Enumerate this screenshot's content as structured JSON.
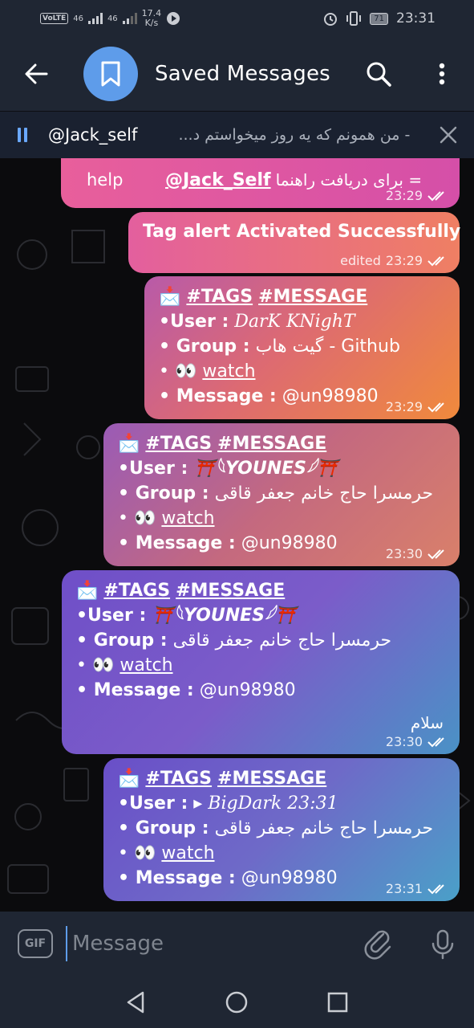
{
  "status_bar": {
    "volte": "VoLTE",
    "signal1": "46",
    "signal2": "46",
    "speed_value": "17.4",
    "speed_unit": "K/s",
    "battery": "71",
    "time": "23:31"
  },
  "header": {
    "title": "Saved Messages"
  },
  "pinned": {
    "sender": "@Jack_self",
    "text": "- من همونم که یه روز میخواستم د..."
  },
  "messages": [
    {
      "text_left": "help",
      "text_link": "@Jack_Self",
      "text_rtl": "= برای دریافت راهنما",
      "time": "23:29"
    },
    {
      "text": "Tag alert Activated Successfully",
      "edited": "edited",
      "time": "23:29"
    },
    {
      "tags": "#TAGS",
      "message_tag": "#MESSAGE",
      "user_label": "•User :",
      "user_value": "DarK KNighT",
      "group_label": "• Group :",
      "group_value": "گیت هاب - Github",
      "watch_prefix": "• 👀",
      "watch_label": "watch",
      "message_label": "• Message :",
      "message_value": "@un98980",
      "time": "23:29"
    },
    {
      "tags": "#TAGS",
      "message_tag": "#MESSAGE",
      "user_label": "•User :",
      "user_value": "⛩️𓆩YOUNES𓆪⛩️",
      "group_label": "• Group :",
      "group_value": "حرمسرا حاج خانم جعفر قاقی",
      "watch_prefix": "• 👀",
      "watch_label": "watch",
      "message_label": "• Message :",
      "message_value": "@un98980",
      "time": "23:30"
    },
    {
      "tags": "#TAGS",
      "message_tag": "#MESSAGE",
      "user_label": "•User :",
      "user_value": "⛩️𓆩YOUNES𓆪⛩️",
      "group_label": "• Group :",
      "group_value": "حرمسرا حاج خانم جعفر قاقی",
      "watch_prefix": "• 👀",
      "watch_label": "watch",
      "message_label": "• Message :",
      "message_value": "@un98980",
      "extra": "سلام",
      "time": "23:30"
    },
    {
      "tags": "#TAGS",
      "message_tag": "#MESSAGE",
      "user_label": "•User :",
      "user_value": "▸ BigDark 23:31",
      "group_label": "• Group :",
      "group_value": "حرمسرا حاج خانم جعفر قاقی",
      "watch_prefix": "• 👀",
      "watch_label": "watch",
      "message_label": "• Message :",
      "message_value": "@un98980",
      "time": "23:31"
    }
  ],
  "input": {
    "gif_label": "GIF",
    "placeholder": "Message"
  },
  "colors": {
    "header_bg": "#1f2633",
    "accent": "#5e9cea",
    "chat_bg": "#0b0b0d"
  },
  "icons": [
    "back-arrow-icon",
    "bookmark-icon",
    "search-icon",
    "more-vert-icon",
    "pin-icon",
    "close-icon",
    "envelope-icon",
    "double-check-icon",
    "attach-icon",
    "mic-icon",
    "nav-back-icon",
    "nav-home-icon",
    "nav-recents-icon"
  ]
}
